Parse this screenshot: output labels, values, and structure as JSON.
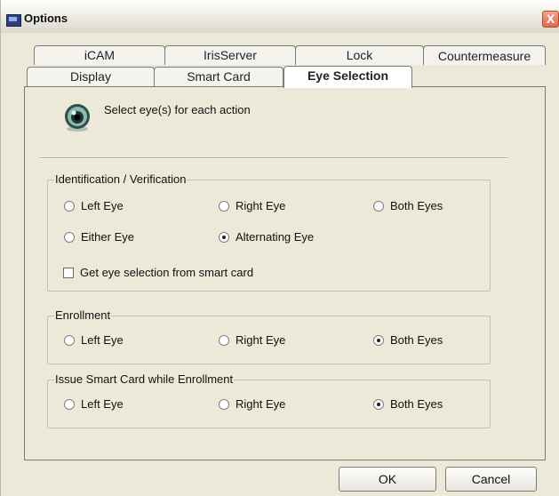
{
  "window": {
    "title": "Options",
    "close_glyph": "X"
  },
  "tabs_row_back": [
    "iCAM",
    "IrisServer",
    "Lock",
    "Countermeasure"
  ],
  "tabs_row_front": [
    "Display",
    "Smart Card",
    "Eye Selection"
  ],
  "active_tab": "Eye Selection",
  "intro_text": "Select eye(s) for each action",
  "icons": {
    "header": "eye-icon",
    "app": "options-window-icon"
  },
  "identification": {
    "legend": "Identification / Verification",
    "options": [
      "Left Eye",
      "Right Eye",
      "Both Eyes",
      "Either Eye",
      "Alternating Eye"
    ],
    "selected": "Alternating Eye",
    "smartcard_checkbox": {
      "label": "Get eye selection from smart card",
      "checked": false
    }
  },
  "enrollment": {
    "legend": "Enrollment",
    "options": [
      "Left Eye",
      "Right Eye",
      "Both Eyes"
    ],
    "selected": "Both Eyes"
  },
  "issue_smart_card": {
    "legend": "Issue Smart Card while Enrollment",
    "options": [
      "Left Eye",
      "Right Eye",
      "Both Eyes"
    ],
    "selected": "Both Eyes"
  },
  "buttons": {
    "ok": "OK",
    "cancel": "Cancel"
  }
}
